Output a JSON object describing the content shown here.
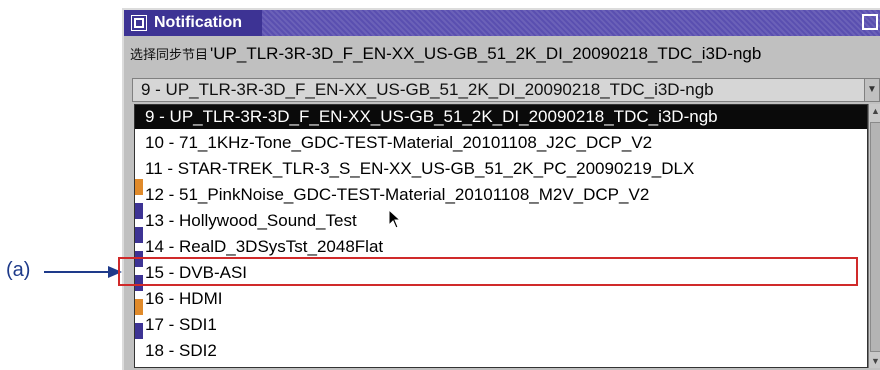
{
  "callout": {
    "label": "(a)"
  },
  "window": {
    "title": "Notification",
    "sync_label": "选择同步节目",
    "sync_value": "'UP_TLR-3R-3D_F_EN-XX_US-GB_51_2K_DI_20090218_TDC_i3D-ngb",
    "combo_value": "9 - UP_TLR-3R-3D_F_EN-XX_US-GB_51_2K_DI_20090218_TDC_i3D-ngb"
  },
  "list": {
    "items": [
      {
        "label": "9 - UP_TLR-3R-3D_F_EN-XX_US-GB_51_2K_DI_20090218_TDC_i3D-ngb",
        "selected": true
      },
      {
        "label": "10 - 71_1KHz-Tone_GDC-TEST-Material_20101108_J2C_DCP_V2"
      },
      {
        "label": "11 - STAR-TREK_TLR-3_S_EN-XX_US-GB_51_2K_PC_20090219_DLX"
      },
      {
        "label": "12 - 51_PinkNoise_GDC-TEST-Material_20101108_M2V_DCP_V2"
      },
      {
        "label": "13 - Hollywood_Sound_Test"
      },
      {
        "label": "14 - RealD_3DSysTst_2048Flat"
      },
      {
        "label": "15 - DVB-ASI",
        "highlighted": true
      },
      {
        "label": "16 - HDMI"
      },
      {
        "label": "17 - SDI1"
      },
      {
        "label": "18 - SDI2"
      }
    ]
  },
  "colors": {
    "titlebar": "#5a4fb0",
    "selection": "#0a0a0a",
    "highlight_border": "#d02a2a",
    "callout": "#1e3a8a"
  }
}
